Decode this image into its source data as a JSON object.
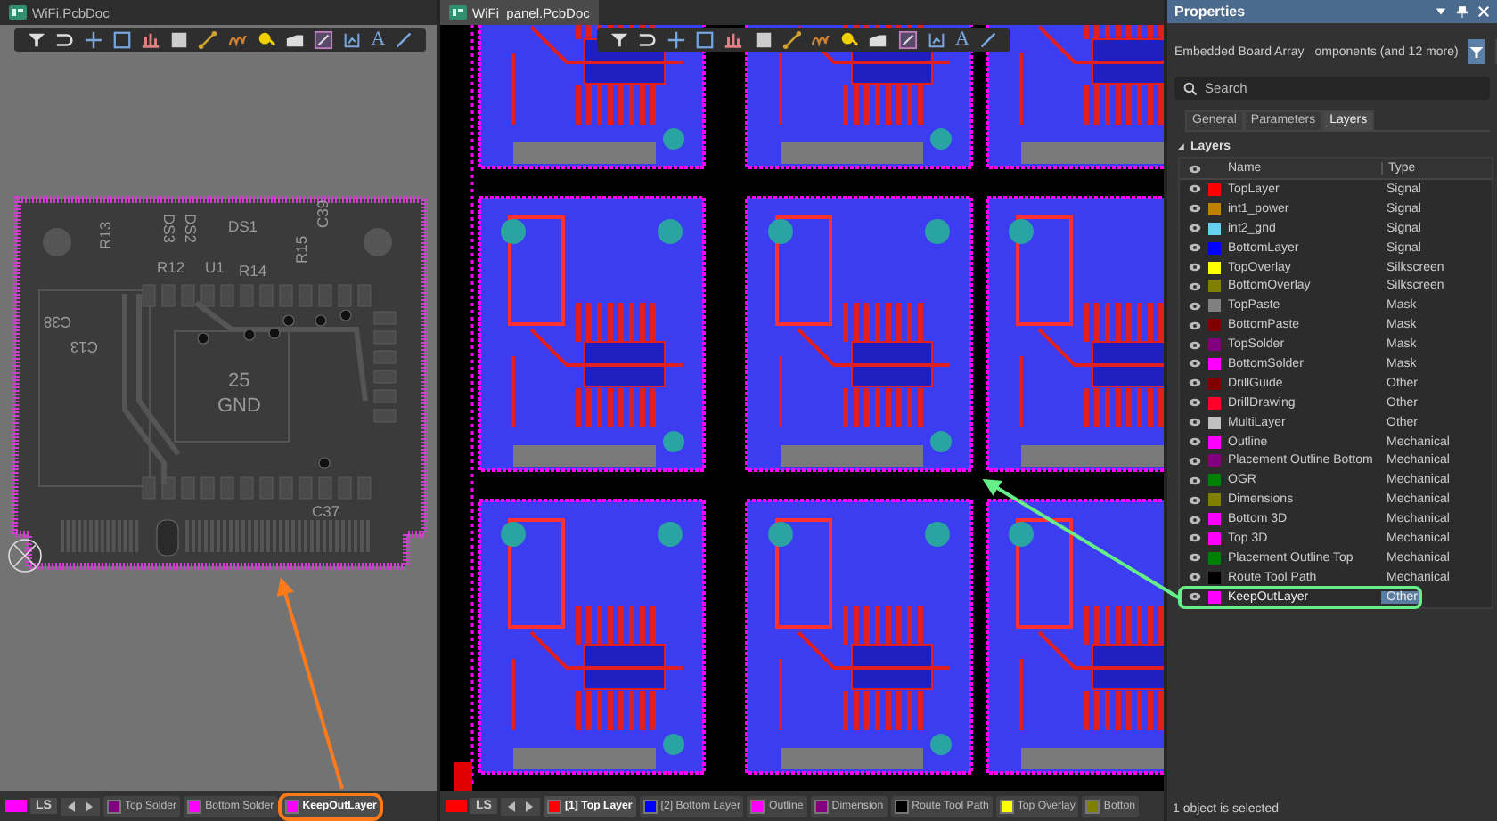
{
  "documents": [
    {
      "title": "WiFi.PcbDoc",
      "active": false,
      "toolbar_text_glyph": "A",
      "board_labels": [
        "DS1",
        "DS2",
        "DS3",
        "R13",
        "R12",
        "U1",
        "R14",
        "R15",
        "C39",
        "C38",
        "C13",
        "25",
        "GND",
        "C37"
      ],
      "layer_bar": {
        "color": "#ff00ff",
        "ls": "LS",
        "tabs": [
          {
            "label": "Top Solder",
            "color": "#800080",
            "selected": false,
            "highlighted": false
          },
          {
            "label": "Bottom Solder",
            "color": "#ff00ff",
            "selected": false,
            "highlighted": false
          },
          {
            "label": "KeepOutLayer",
            "color": "#ff00ff",
            "selected": true,
            "highlighted": true
          }
        ]
      }
    },
    {
      "title": "WiFi_panel.PcbDoc",
      "active": true,
      "toolbar_text_glyph": "A",
      "layer_bar": {
        "color": "#ff0000",
        "ls": "LS",
        "tabs": [
          {
            "label": "[1] Top Layer",
            "color": "#ff0000",
            "selected": true,
            "highlighted": false
          },
          {
            "label": "[2] Bottom Layer",
            "color": "#0000ff",
            "selected": false,
            "highlighted": false
          },
          {
            "label": "Outline",
            "color": "#ff00ff",
            "selected": false,
            "highlighted": false
          },
          {
            "label": "Dimension",
            "color": "#800080",
            "selected": false,
            "highlighted": false
          },
          {
            "label": "Route Tool Path",
            "color": "#000000",
            "selected": false,
            "highlighted": false
          },
          {
            "label": "Top Overlay",
            "color": "#ffff00",
            "selected": false,
            "highlighted": false
          },
          {
            "label": "Botton",
            "color": "#808000",
            "selected": false,
            "highlighted": false
          }
        ]
      }
    }
  ],
  "properties": {
    "title": "Properties",
    "selection_label": "Embedded Board Array",
    "filter_label": "omponents (and 12 more)",
    "search": {
      "placeholder": "Search"
    },
    "tabs": [
      {
        "label": "General",
        "selected": false
      },
      {
        "label": "Parameters",
        "selected": false
      },
      {
        "label": "Layers",
        "selected": true
      }
    ],
    "section": {
      "title": "Layers",
      "expanded": true
    },
    "columns": [
      "Name",
      "Type"
    ],
    "layers": [
      {
        "name": "TopLayer",
        "type": "Signal",
        "color": "#ff0000",
        "selected": false
      },
      {
        "name": "int1_power",
        "type": "Signal",
        "color": "#c08000",
        "selected": false
      },
      {
        "name": "int2_gnd",
        "type": "Signal",
        "color": "#66d0f0",
        "selected": false
      },
      {
        "name": "BottomLayer",
        "type": "Signal",
        "color": "#0000ff",
        "selected": false
      },
      {
        "name": "TopOverlay",
        "type": "Silkscreen",
        "color": "#ffff00",
        "selected": false
      },
      {
        "name": "BottomOverlay",
        "type": "Silkscreen",
        "color": "#808000",
        "selected": false
      },
      {
        "name": "TopPaste",
        "type": "Mask",
        "color": "#808080",
        "selected": false
      },
      {
        "name": "BottomPaste",
        "type": "Mask",
        "color": "#800000",
        "selected": false
      },
      {
        "name": "TopSolder",
        "type": "Mask",
        "color": "#800080",
        "selected": false
      },
      {
        "name": "BottomSolder",
        "type": "Mask",
        "color": "#ff00ff",
        "selected": false
      },
      {
        "name": "DrillGuide",
        "type": "Other",
        "color": "#800000",
        "selected": false
      },
      {
        "name": "DrillDrawing",
        "type": "Other",
        "color": "#ff002a",
        "selected": false
      },
      {
        "name": "MultiLayer",
        "type": "Other",
        "color": "#c0c0c0",
        "selected": false
      },
      {
        "name": "Outline",
        "type": "Mechanical",
        "color": "#ff00ff",
        "selected": false
      },
      {
        "name": "Placement Outline Bottom",
        "type": "Mechanical",
        "color": "#800080",
        "selected": false
      },
      {
        "name": "OGR",
        "type": "Mechanical",
        "color": "#008000",
        "selected": false
      },
      {
        "name": "Dimensions",
        "type": "Mechanical",
        "color": "#808000",
        "selected": false
      },
      {
        "name": "Bottom 3D",
        "type": "Mechanical",
        "color": "#ff00ff",
        "selected": false
      },
      {
        "name": "Top 3D",
        "type": "Mechanical",
        "color": "#ff00ff",
        "selected": false
      },
      {
        "name": "Placement Outline Top",
        "type": "Mechanical",
        "color": "#008000",
        "selected": false
      },
      {
        "name": "Route Tool Path",
        "type": "Mechanical",
        "color": "#000000",
        "selected": false
      },
      {
        "name": "KeepOutLayer",
        "type": "Other",
        "color": "#ff00ff",
        "selected": true
      }
    ],
    "status": "1 object is selected"
  }
}
